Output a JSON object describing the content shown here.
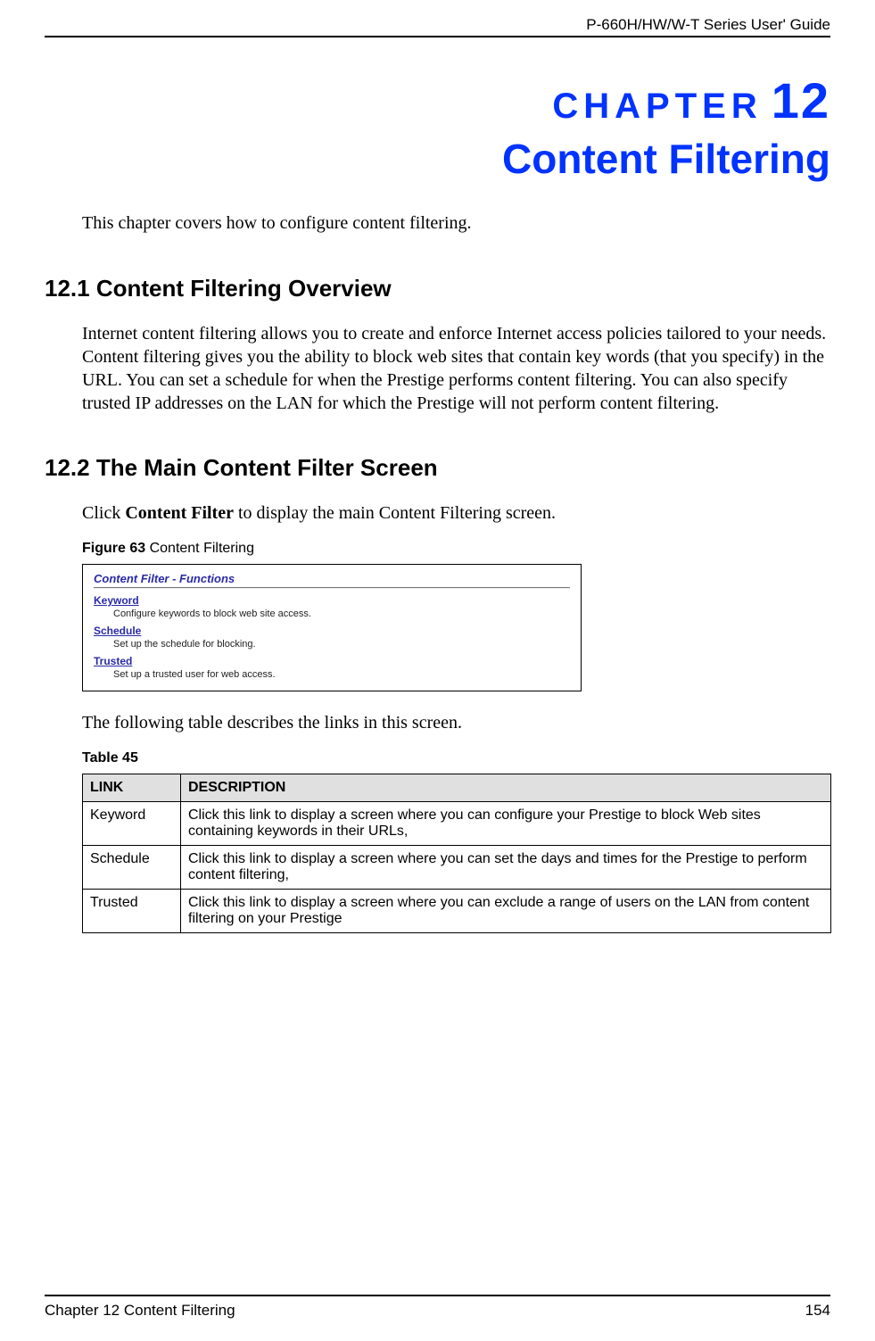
{
  "header": {
    "guide_title": "P-660H/HW/W-T Series User' Guide"
  },
  "chapter": {
    "label": "CHAPTER",
    "number": "12",
    "title": "Content Filtering",
    "intro": "This chapter covers how to configure content filtering."
  },
  "sections": {
    "s1": {
      "heading": "12.1  Content Filtering Overview",
      "para": "Internet content filtering allows you to create and enforce Internet access policies tailored to your needs. Content filtering gives you the ability to block web sites that contain key words (that you specify) in the URL. You can set a schedule for when the Prestige performs content filtering. You can also specify trusted IP addresses on the LAN for which the Prestige will not perform content filtering."
    },
    "s2": {
      "heading": "12.2  The Main Content Filter Screen",
      "lead_pre": "Click ",
      "lead_bold": "Content Filter",
      "lead_post": " to display the main Content Filtering screen.",
      "figure": {
        "caption_label": "Figure 63",
        "caption_text": "   Content Filtering",
        "panel_title": "Content Filter - Functions",
        "links": [
          {
            "name": "Keyword",
            "desc": "Configure keywords to block web site access."
          },
          {
            "name": "Schedule",
            "desc": "Set up the schedule for blocking."
          },
          {
            "name": "Trusted",
            "desc": "Set up a trusted user for web access."
          }
        ]
      },
      "after_figure": "The following table describes the links in this screen.",
      "table": {
        "caption": "Table 45",
        "headers": {
          "link": "LINK",
          "desc": "DESCRIPTION"
        },
        "rows": [
          {
            "link": "Keyword",
            "desc": "Click this link to display a screen where you can configure your Prestige to block Web sites containing keywords in their URLs,"
          },
          {
            "link": "Schedule",
            "desc": "Click this link to display a screen where you can set the days and times for the Prestige to perform content filtering,"
          },
          {
            "link": "Trusted",
            "desc": "Click this link to display a screen where you can exclude a range of users on the LAN from content filtering on your Prestige"
          }
        ]
      }
    }
  },
  "footer": {
    "left": "Chapter 12 Content Filtering",
    "right": "154"
  }
}
